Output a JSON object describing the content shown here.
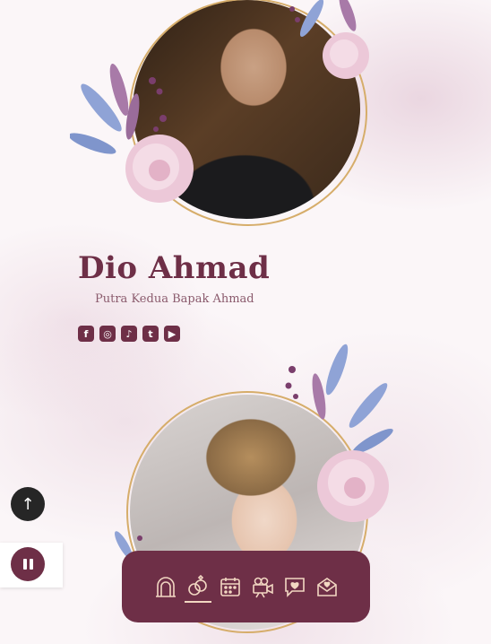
{
  "groom": {
    "name": "Dio Ahmad",
    "subtitle": "Putra Kedua Bapak Ahmad",
    "socials": [
      {
        "icon": "facebook-icon",
        "glyph": "f"
      },
      {
        "icon": "instagram-icon",
        "glyph": "◎"
      },
      {
        "icon": "tiktok-icon",
        "glyph": "♪"
      },
      {
        "icon": "twitter-icon",
        "glyph": "t"
      },
      {
        "icon": "youtube-icon",
        "glyph": "▶"
      }
    ]
  },
  "floating": {
    "scroll_top_glyph": "↑"
  },
  "nav": {
    "items": [
      {
        "icon": "couple-arch-icon",
        "active": false
      },
      {
        "icon": "rings-icon",
        "active": true
      },
      {
        "icon": "calendar-icon",
        "active": false
      },
      {
        "icon": "video-camera-icon",
        "active": false
      },
      {
        "icon": "love-chat-icon",
        "active": false
      },
      {
        "icon": "envelope-icon",
        "active": false
      }
    ]
  },
  "colors": {
    "primary": "#6e2f47",
    "gold": "#d6ad6a",
    "dark": "#262626",
    "nav_icon": "#f2d7c2"
  }
}
